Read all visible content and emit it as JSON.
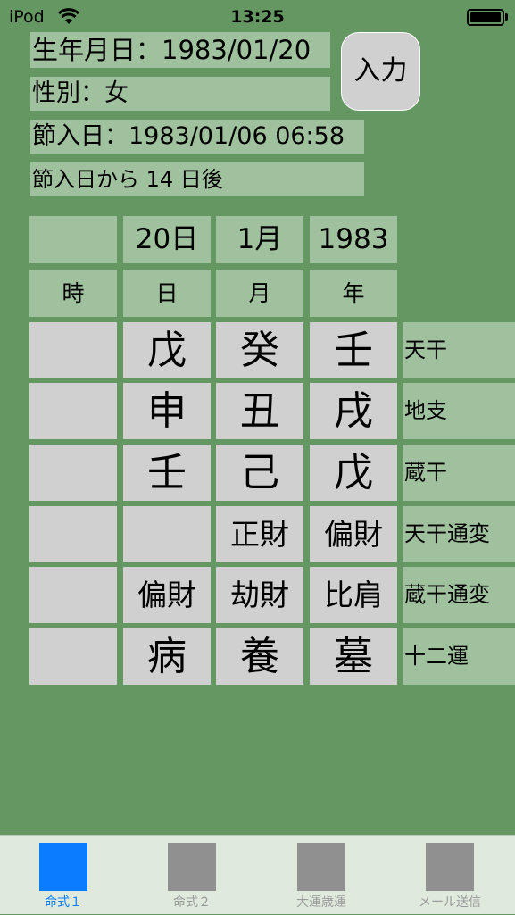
{
  "status_bar": {
    "carrier": "iPod",
    "time": "13:25",
    "wifi_icon": "wifi-icon",
    "battery_icon": "battery-icon"
  },
  "info": {
    "birth_date": "生年月日：1983/01/20",
    "gender": "性別：女",
    "setsuiri_date": "節入日：1983/01/06 06:58",
    "days_after": "節入日から 14 日後"
  },
  "input_button": {
    "label": "入力"
  },
  "table": {
    "date_headers": [
      "",
      "20日",
      "1月",
      "1983"
    ],
    "pillar_headers": [
      "時",
      "日",
      "月",
      "年"
    ],
    "rows": [
      {
        "label": "天干",
        "cells": [
          "",
          "戊",
          "癸",
          "壬"
        ]
      },
      {
        "label": "地支",
        "cells": [
          "",
          "申",
          "丑",
          "戌"
        ]
      },
      {
        "label": "蔵干",
        "cells": [
          "",
          "壬",
          "己",
          "戊"
        ]
      },
      {
        "label": "天干通変",
        "cells": [
          "",
          "",
          "正財",
          "偏財"
        ]
      },
      {
        "label": "蔵干通変",
        "cells": [
          "",
          "偏財",
          "劫財",
          "比肩"
        ]
      },
      {
        "label": "十二運",
        "cells": [
          "",
          "病",
          "養",
          "墓"
        ]
      }
    ]
  },
  "tabs": [
    {
      "label": "命式１",
      "active": true
    },
    {
      "label": "命式２",
      "active": false
    },
    {
      "label": "大運歳運",
      "active": false
    },
    {
      "label": "メール送信",
      "active": false
    }
  ],
  "colors": {
    "background": "#659763",
    "label_bg": "#a0c19e",
    "cell_bg": "#d0d0d0",
    "accent": "#0a7cff"
  }
}
